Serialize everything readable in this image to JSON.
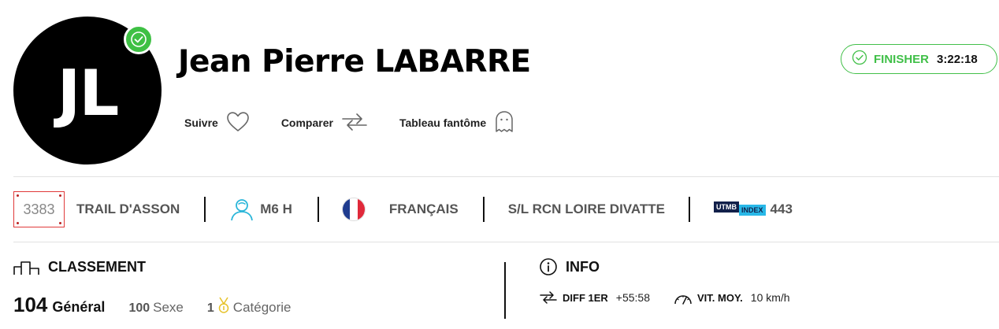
{
  "runner": {
    "initials": "JL",
    "name": "Jean Pierre LABARRE"
  },
  "actions": {
    "follow": "Suivre",
    "compare": "Comparer",
    "ghost": "Tableau fantôme"
  },
  "status": {
    "label": "FINISHER",
    "time": "3:22:18",
    "color": "#3fbf47"
  },
  "details": {
    "bib": "3383",
    "race": "TRAIL D'ASSON",
    "category": "M6 H",
    "nationality": "FRANÇAIS",
    "club": "S/L RCN LOIRE DIVATTE",
    "utmb_brand": "UTMB",
    "utmb_index_label": "INDEX",
    "utmb_index": "443"
  },
  "ranking": {
    "title": "CLASSEMENT",
    "general_value": "104",
    "general_label": "Général",
    "sex_value": "100",
    "sex_label": "Sexe",
    "category_value": "1",
    "category_label": "Catégorie"
  },
  "info": {
    "title": "INFO",
    "diff_label": "DIFF 1ER",
    "diff_value": "+55:58",
    "speed_label": "VIT. MOY.",
    "speed_value": "10 km/h"
  },
  "colors": {
    "accent_green": "#3fbf47",
    "bib_red": "#e03a3a",
    "category_icon_cyan": "#2bb6d9",
    "utmb_navy": "#12204a",
    "utmb_cyan": "#28b8e8",
    "medal_gold": "#e6c229"
  }
}
